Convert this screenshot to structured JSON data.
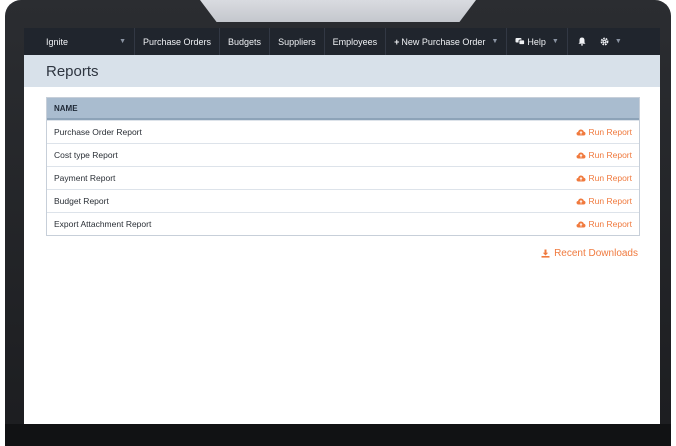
{
  "nav": {
    "brand": "Ignite",
    "items": [
      "Purchase Orders",
      "Budgets",
      "Suppliers",
      "Employees"
    ],
    "new_po": "New Purchase Order",
    "help": "Help"
  },
  "page": {
    "title": "Reports"
  },
  "table": {
    "header": "NAME",
    "action_label": "Run Report",
    "rows": [
      "Purchase Order Report",
      "Cost type Report",
      "Payment Report",
      "Budget Report",
      "Export Attachment Report"
    ]
  },
  "recent_downloads": "Recent Downloads",
  "colors": {
    "navbar": "#20252d",
    "subheader": "#d8e1ea",
    "table_header": "#a9bccf",
    "accent": "#f07a3e"
  },
  "icons": [
    "chevron-down-icon",
    "plus-icon",
    "help-icon",
    "bell-icon",
    "gear-icon",
    "cloud-upload-icon",
    "download-icon"
  ]
}
